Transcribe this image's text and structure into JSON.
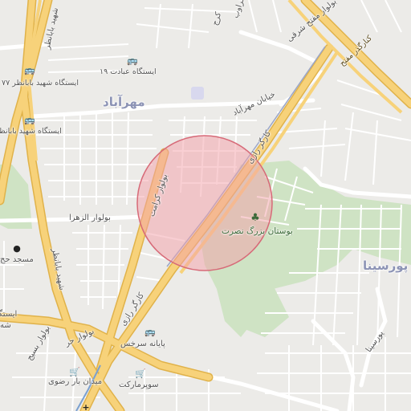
{
  "map": {
    "area_labels": {
      "mehrabad": "مهرآباد",
      "poursina": "پورسینا"
    },
    "road_labels": {
      "kargar_ramp_top": "کنارگذر مفتح",
      "motahari_blvd": "بولوار مفتح شرقی",
      "karaj_top": "کرج",
      "karaj_top2": "کراوب",
      "mehrabad_street": "خیابان مهرآباد",
      "kargar_razi": "کارگر رازی",
      "kargar_razi_south": "کارگر رازی",
      "blvd_keramat": "بولوار کرامت",
      "blvd_alzahra": "بولوار الزهرا",
      "bakheshmorad": "شهید بابانظر",
      "poursina_street": "پورسینا",
      "blvd_hor": "بولوار حر",
      "tarh_basij": "بولوار بسیج"
    },
    "poi_labels": {
      "bus_station_babanazar_77": "ایستگاه شهید بابانظر ۷۷",
      "bus_station_ebadat_19": "ایستگاه عبادت ۱۹",
      "bus_station_babanazar": "ایستگاه شهید بابانظر",
      "park_nosrat": "بوستان بزرگ نصرت",
      "mosque": "مسجد حج",
      "payane_sarkhas": "پایانه سرخس",
      "supermarket": "سوپرمارکت",
      "meydan_bar_razavi": "میدان بار رضوی",
      "istgah_left": "ایستگاه",
      "istgah_left2": "شه"
    },
    "icons": {
      "bus": "bus-icon",
      "park": "tree-icon",
      "mosque": "mosque-icon",
      "shop": "shopping-cart-icon",
      "hospital": "medical-cross-icon"
    },
    "colors": {
      "background": "#ecebe8",
      "highway": "#f7d27a",
      "highway_casing": "#e0b24a",
      "street": "#ffffff",
      "park": "#cfe3c4",
      "circle_fill": "#f3a0a8",
      "circle_stroke": "#d76a78"
    }
  }
}
